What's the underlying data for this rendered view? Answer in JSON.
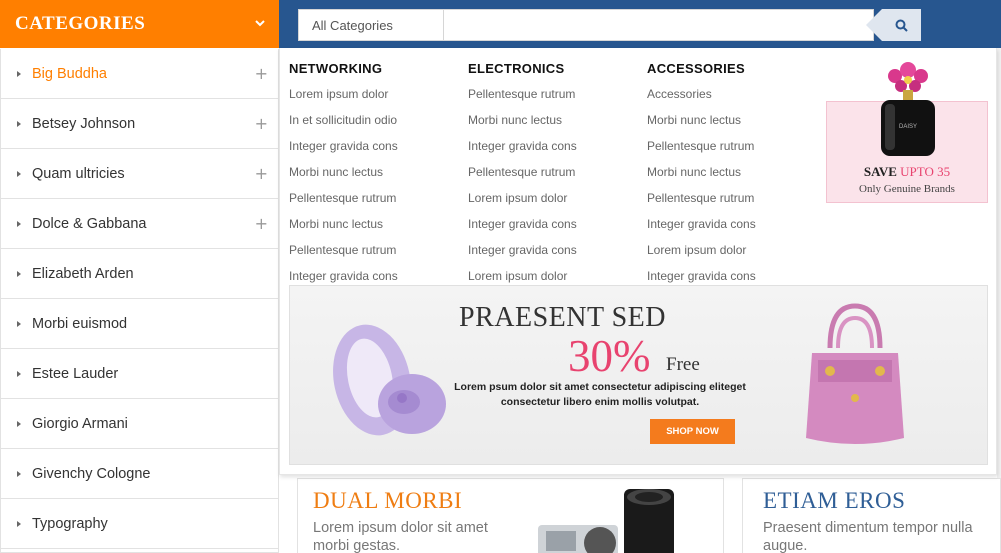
{
  "categories_header": {
    "title": "CATEGORIES",
    "toggle_icon": "chevron-down-icon"
  },
  "search": {
    "category_value": "All Categories",
    "input_placeholder": "",
    "button_icon": "search-icon"
  },
  "sidebar": {
    "items": [
      {
        "label": "Big Buddha",
        "active": true,
        "expandable": true
      },
      {
        "label": "Betsey Johnson",
        "active": false,
        "expandable": true
      },
      {
        "label": "Quam ultricies",
        "active": false,
        "expandable": true
      },
      {
        "label": "Dolce & Gabbana",
        "active": false,
        "expandable": true
      },
      {
        "label": "Elizabeth Arden",
        "active": false,
        "expandable": false
      },
      {
        "label": "Morbi euismod",
        "active": false,
        "expandable": false
      },
      {
        "label": "Estee Lauder",
        "active": false,
        "expandable": false
      },
      {
        "label": "Giorgio Armani",
        "active": false,
        "expandable": false
      },
      {
        "label": "Givenchy Cologne",
        "active": false,
        "expandable": false
      },
      {
        "label": "Typography",
        "active": false,
        "expandable": false
      }
    ]
  },
  "mega_menu": {
    "columns": [
      {
        "heading": "NETWORKING",
        "links": [
          "Lorem ipsum dolor",
          "In et sollicitudin odio",
          "Integer gravida cons",
          "Morbi nunc lectus",
          "Pellentesque rutrum",
          "Morbi nunc lectus",
          "Pellentesque rutrum",
          "Integer gravida cons"
        ]
      },
      {
        "heading": "ELECTRONICS",
        "links": [
          "Pellentesque rutrum",
          "Morbi nunc lectus",
          "Integer gravida cons",
          "Pellentesque rutrum",
          "Lorem ipsum dolor",
          "Integer gravida cons",
          "Integer gravida cons",
          "Lorem ipsum dolor"
        ]
      },
      {
        "heading": "ACCESSORIES",
        "links": [
          "Accessories",
          "Morbi nunc lectus",
          "Pellentesque rutrum",
          "Morbi nunc lectus",
          "Pellentesque rutrum",
          "Integer gravida cons",
          "Lorem ipsum dolor",
          "Integer gravida cons"
        ]
      }
    ],
    "promo": {
      "save_text": "SAVE",
      "save_highlight": "UPTO 35",
      "subtitle": "Only Genuine Brands",
      "bottle_label": "DAISY"
    },
    "banner": {
      "title": "PRAESENT SED",
      "percent": "30%",
      "free": "Free",
      "description": "Lorem psum dolor sit amet consectetur adipiscing eliteget consectetur libero enim mollis volutpat.",
      "button": "SHOP NOW"
    }
  },
  "blocks": [
    {
      "title": "DUAL MORBI",
      "text": "Lorem ipsum dolor sit amet morbi gestas.",
      "title_color": "#ef7d12"
    },
    {
      "title": "ETIAM EROS",
      "text": "Praesent dimentum tempor nulla augue.",
      "title_color": "#2f5e96"
    }
  ],
  "colors": {
    "accent_orange": "#ff7f00",
    "header_blue": "#27568f",
    "pink": "#e8436f"
  }
}
